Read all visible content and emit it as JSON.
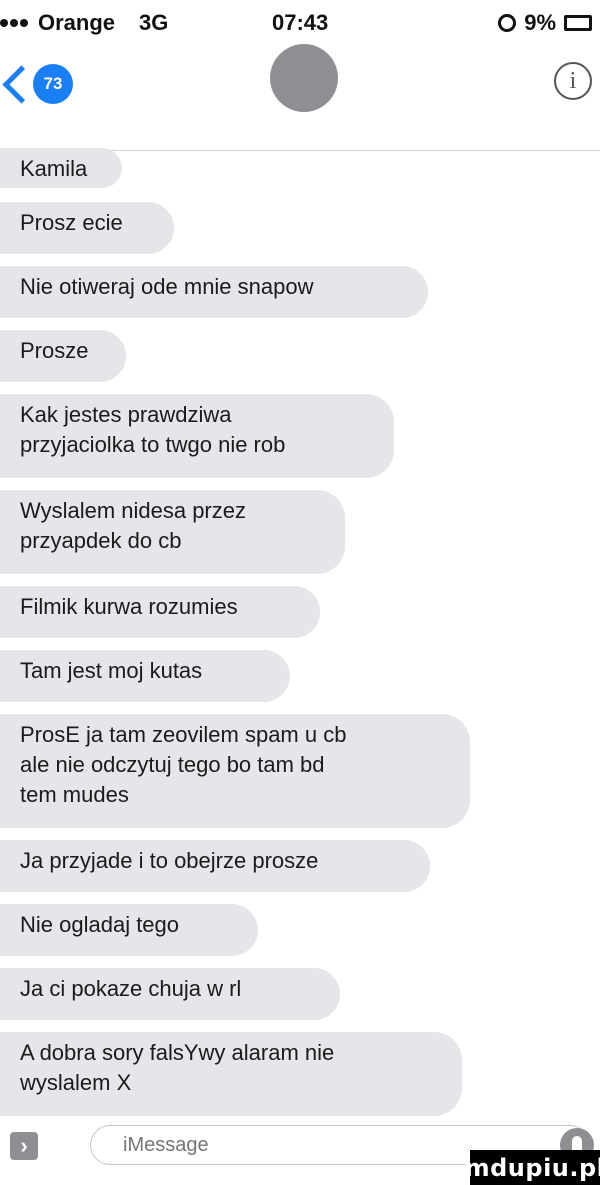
{
  "status_bar": {
    "carrier": "Orange",
    "network": "3G",
    "time": "07:43",
    "battery": "9%"
  },
  "nav": {
    "unread_count": "73",
    "back_icon": "chevron-left-icon",
    "info_icon": "info-icon"
  },
  "messages": [
    "Kamila",
    "Prosz ecie",
    "Nie otiweraj ode mnie snapow",
    "Prosze",
    "Kak jestes prawdziwa\nprzyjaciolka to twgo nie rob",
    "Wyslalem nidesa przez\nprzyapdek do cb",
    "Filmik kurwa rozumies",
    "Tam jest moj kutas",
    "ProsE ja tam zeovilem spam u cb\nale nie odczytuj tego bo tam bd\ntem mudes",
    "Ja przyjade i to obejrze prosze",
    "Nie ogladaj tego",
    "Ja ci pokaze chuja w rl",
    "A dobra sory falsYwy alaram nie\nwyslalem X"
  ],
  "input": {
    "placeholder": "iMessage"
  },
  "watermark": "mdupiu.pl",
  "colors": {
    "bubble": "#e5e5ea",
    "accent": "#1a7ef5"
  }
}
